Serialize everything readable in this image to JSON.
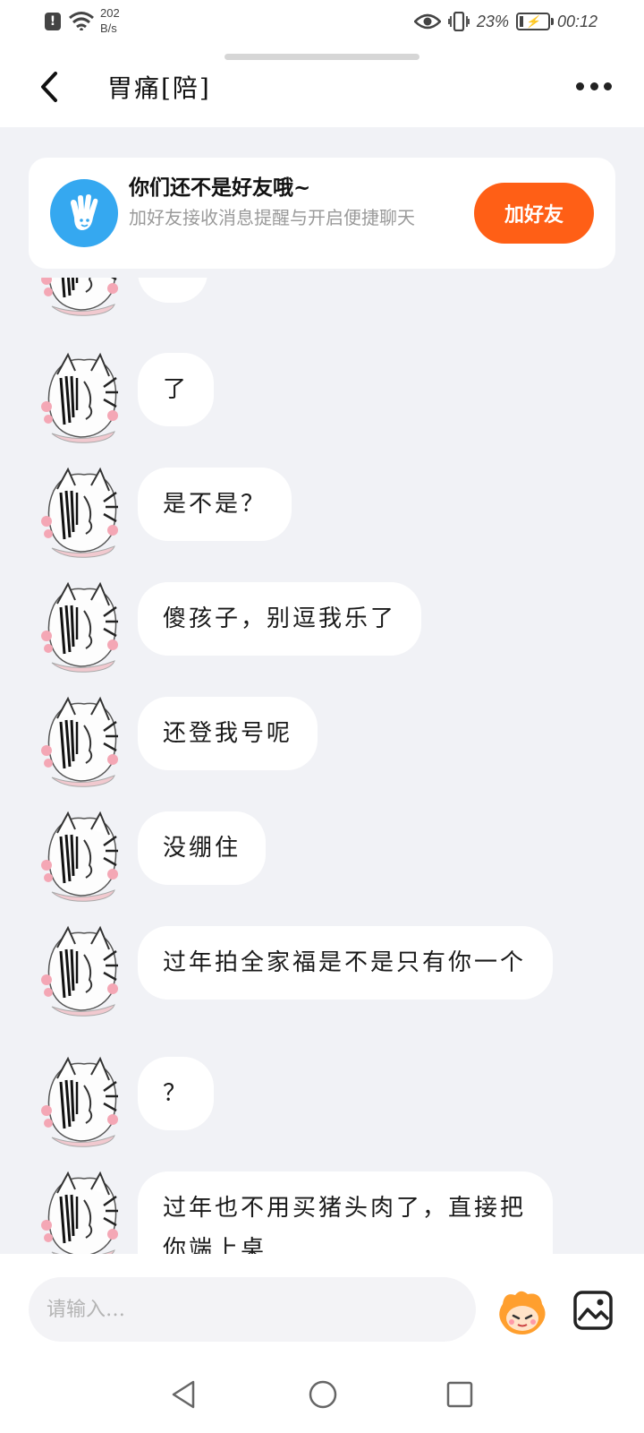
{
  "status_bar": {
    "net_speed_value": "202",
    "net_speed_unit": "B/s",
    "battery_percent": "23%",
    "battery_level": 0.23,
    "time": "00:12"
  },
  "header": {
    "title": "胃痛[陪]"
  },
  "friend_banner": {
    "title": "你们还不是好友哦~",
    "subtitle": "加好友接收消息提醒与开启便捷聊天",
    "button_label": "加好友"
  },
  "messages": [
    {
      "text": "了"
    },
    {
      "text": "是不是？"
    },
    {
      "text": "傻孩子，别逗我乐了"
    },
    {
      "text": "还登我号呢"
    },
    {
      "text": "没绷住"
    },
    {
      "text": "过年拍全家福是不是只有你一个"
    },
    {
      "text": "？"
    },
    {
      "text": "过年也不用买猪头肉了，直接把你端上桌"
    }
  ],
  "input_bar": {
    "placeholder": "请输入…"
  },
  "colors": {
    "accent": "#ff5f16",
    "banner_icon_bg": "#35a8f0",
    "background": "#f1f2f6"
  },
  "icons": {
    "back": "chevron-left-icon",
    "more": "more-dots-icon",
    "emoji": "emoji-face-icon",
    "image": "image-icon",
    "banner": "hand-wave-icon"
  }
}
